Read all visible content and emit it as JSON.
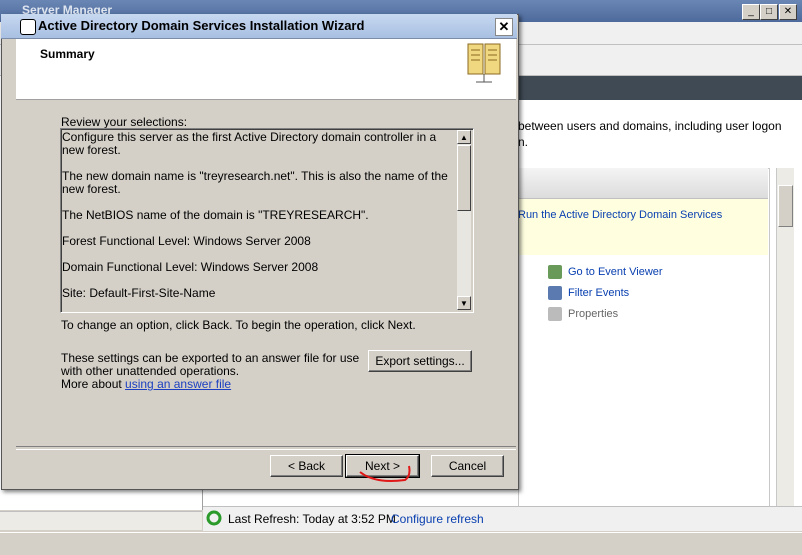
{
  "server_manager": {
    "title": "Server Manager",
    "description": "between users and domains, including user logon",
    "description_line2": "n.",
    "panel_link": "Run the Active Directory Domain Services",
    "actions": [
      {
        "label": "Go to Event Viewer",
        "icon": "event-viewer-icon"
      },
      {
        "label": "Filter Events",
        "icon": "filter-icon"
      },
      {
        "label": "Properties",
        "icon": "properties-icon"
      }
    ],
    "last_refresh": "Last Refresh: Today at 3:52 PM",
    "configure_refresh": "Configure refresh"
  },
  "wizard": {
    "title": "Active Directory Domain Services Installation Wizard",
    "heading": "Summary",
    "review_label": "Review your selections:",
    "summary_lines": [
      "Configure this server as the first Active Directory domain controller in a new forest.",
      "The new domain name is \"treyresearch.net\". This is also the name of the new forest.",
      "The NetBIOS name of the domain is \"TREYRESEARCH\".",
      "Forest Functional Level: Windows Server 2008",
      "Domain Functional Level: Windows Server 2008",
      "Site: Default-First-Site-Name"
    ],
    "change_text": "To change an option, click Back. To begin the operation, click Next.",
    "export_text": "These settings can be exported to an answer file for use with other unattended operations.",
    "more_about": "More about",
    "answer_link": "using an answer file",
    "export_button": "Export settings...",
    "back_button": "< Back",
    "next_button": "Next >",
    "cancel_button": "Cancel",
    "close_glyph": "✕"
  },
  "colors": {
    "link": "#0a40b0",
    "annotation": "#e01818"
  }
}
